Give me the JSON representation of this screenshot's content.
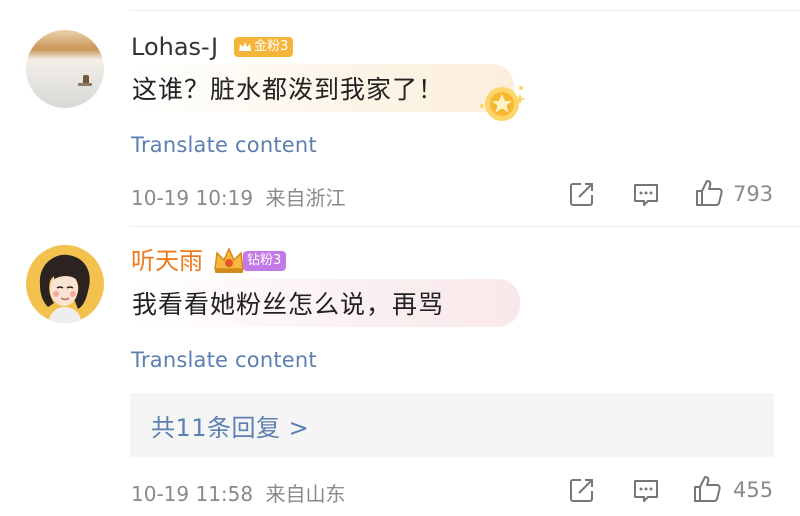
{
  "comments": [
    {
      "username": "Lohas-J",
      "badge": "金粉3",
      "text": "这谁？脏水都泼到我家了！",
      "translate": "Translate content",
      "time": "10-19 10:19",
      "location": "来自浙江",
      "likes": "793"
    },
    {
      "username": "听天雨",
      "badge": "钻粉3",
      "text": "我看看她粉丝怎么说，再骂",
      "translate": "Translate content",
      "replies": "共11条回复 >",
      "time": "10-19 11:58",
      "location": "来自山东",
      "likes": "455"
    }
  ],
  "colors": {
    "username_default": "#333333",
    "username_vip": "#f07a1b",
    "link": "#5b7fb0",
    "meta": "#8a8a8a",
    "badge_gold": "#f4b53a",
    "badge_diamond": "#c47ae6"
  },
  "icons": [
    "share-icon",
    "comment-icon",
    "like-icon",
    "crown-icon",
    "star-decoration-icon"
  ]
}
